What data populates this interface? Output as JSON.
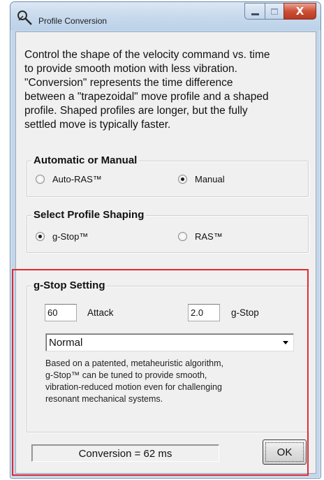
{
  "window": {
    "title": "Profile Conversion",
    "icon": "probe-icon",
    "caption_buttons": {
      "minimize": "minimize-icon",
      "maximize": "maximize-icon",
      "close": "X"
    }
  },
  "description": "Control the shape of the velocity command vs. time\nto provide smooth motion with less vibration.\n\"Conversion\" represents the time difference\nbetween a \"trapezoidal\" move profile and a shaped\nprofile. Shaped profiles are longer, but the fully\nsettled move is typically faster.",
  "automatic_group": {
    "title": "Automatic or Manual",
    "options": [
      {
        "label": "Auto-RAS™",
        "checked": false
      },
      {
        "label": "Manual",
        "checked": true
      }
    ]
  },
  "shaping_group": {
    "title": "Select Profile Shaping",
    "options": [
      {
        "label": "g-Stop™",
        "checked": true
      },
      {
        "label": "RAS™",
        "checked": false
      }
    ]
  },
  "gstop_group": {
    "title": "g-Stop Setting",
    "attack_value": "60",
    "attack_label": "Attack",
    "gstop_value": "2.0",
    "gstop_label": "g-Stop",
    "preset_selected": "Normal",
    "note": "Based on a patented, metaheuristic algorithm,\ng-Stop™ can be tuned to provide smooth,\nvibration-reduced motion even for challenging\nresonant mechanical systems."
  },
  "status": {
    "conversion_text": "Conversion = 62 ms"
  },
  "buttons": {
    "ok_label": "OK"
  },
  "colors": {
    "highlight": "#e02a32",
    "close_button": "#c9452c",
    "frame": "#c4d6ea"
  }
}
